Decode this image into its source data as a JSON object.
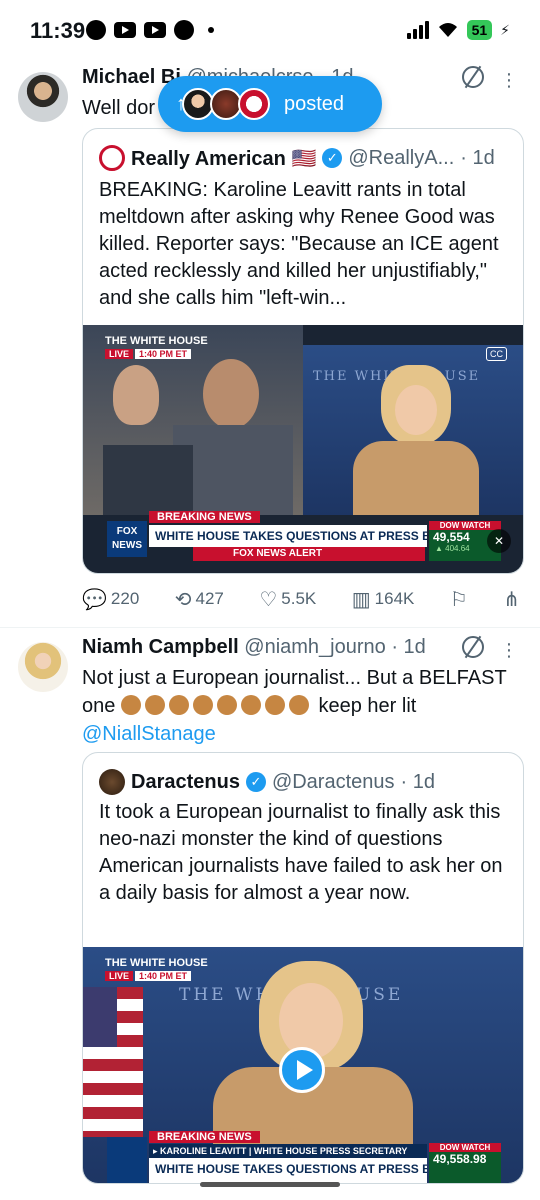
{
  "status_bar": {
    "time": "11:39",
    "battery": "51"
  },
  "new_posts_pill": {
    "label": "posted"
  },
  "tweets": [
    {
      "name": "Michael Bi",
      "handle": "@michaelc",
      "handle_suffix": "rse",
      "time": "· 1d",
      "text": "Well dor",
      "quote": {
        "name": "Really American 🇺🇸",
        "handle": "@ReallyA...",
        "time": "· 1d",
        "text": "BREAKING: Karoline Leavitt rants in total meltdown after asking why Renee Good was killed. Reporter says: \"Because an ICE agent acted recklessly and killed her unjustifiably,\" and she calls him \"left-win...",
        "video": {
          "tag": "THE WHITE HOUSE",
          "live": "LIVE",
          "live_time": "1:40 PM ET",
          "breaking": "BREAKING NEWS",
          "headline": "WHITE HOUSE TAKES QUESTIONS AT PRESS BRIEFING",
          "network": "FOX NEWS",
          "alert": "FOX NEWS ALERT",
          "dow_label": "DOW WATCH",
          "dow_value": "49,554",
          "dow_change": "▲ 404.64",
          "backdrop": "THE WHITE HOUSE",
          "cc": "CC"
        }
      },
      "actions": {
        "replies": "220",
        "reposts": "427",
        "likes": "5.5K",
        "views": "164K"
      }
    },
    {
      "name": "Niamh Campbell",
      "handle": "@niamh_journo",
      "time": "· 1d",
      "text_a": "Not just a European journalist... But a BELFAST one",
      "text_b": "keep her lit",
      "mention": "@NiallStanage",
      "quote": {
        "name": "Daractenus",
        "handle": "@Daractenus",
        "time": "· 1d",
        "text": "It took a European journalist to finally ask this neo-nazi monster the kind of questions American journalists have failed to ask her on a daily basis for almost a year now.",
        "video": {
          "tag": "THE WHITE HOUSE",
          "live": "LIVE",
          "live_time": "1:40 PM ET",
          "breaking": "BREAKING NEWS",
          "lower": "▸ KAROLINE LEAVITT | WHITE HOUSE PRESS SECRETARY",
          "headline": "WHITE HOUSE TAKES QUESTIONS AT PRESS BRIEFING",
          "dow_label": "DOW WATCH",
          "dow_value": "49,558.98",
          "backdrop": "THE WHITE HOUSE"
        }
      }
    }
  ],
  "colors": {
    "accent": "#1d9bf0",
    "muted": "#536471",
    "fox_red": "#c8102e",
    "fox_blue": "#0a3a7a"
  }
}
